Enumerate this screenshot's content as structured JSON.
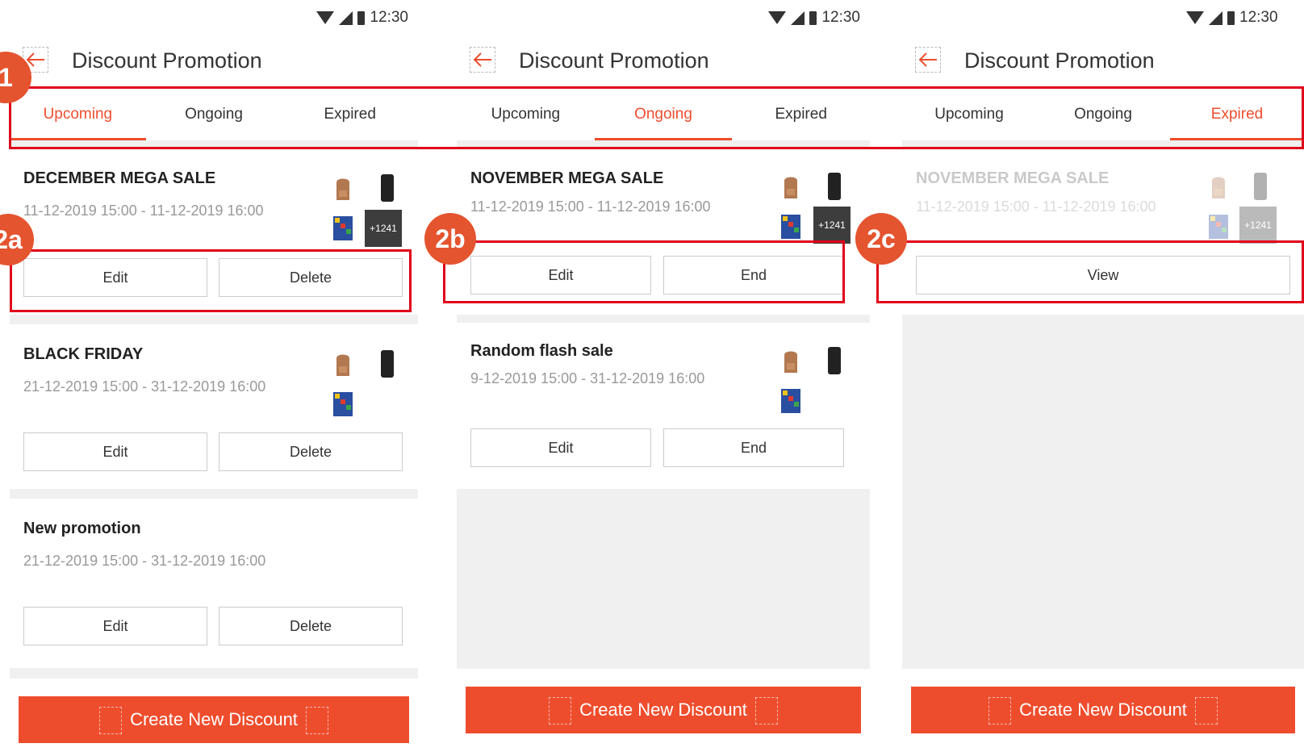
{
  "status": {
    "time": "12:30"
  },
  "header": {
    "title": "Discount Promotion"
  },
  "tabs": [
    "Upcoming",
    "Ongoing",
    "Expired"
  ],
  "labels": {
    "edit": "Edit",
    "delete": "Delete",
    "end": "End",
    "view": "View",
    "create": "Create New Discount",
    "more_count": "+1241"
  },
  "screens": [
    {
      "active_tab": "Upcoming",
      "items": [
        {
          "name": "DECEMBER MEGA SALE",
          "date": "11-12-2019 15:00 - 11-12-2019 16:00"
        },
        {
          "name": "BLACK FRIDAY",
          "date": "21-12-2019 15:00 - 31-12-2019 16:00"
        },
        {
          "name": "New promotion",
          "date": "21-12-2019 15:00 - 31-12-2019 16:00"
        }
      ]
    },
    {
      "active_tab": "Ongoing",
      "items": [
        {
          "name": "NOVEMBER MEGA SALE",
          "date": "11-12-2019 15:00 - 11-12-2019 16:00"
        },
        {
          "name": "Random flash sale",
          "date": "9-12-2019 15:00 - 31-12-2019 16:00"
        }
      ]
    },
    {
      "active_tab": "Expired",
      "items": [
        {
          "name": "NOVEMBER MEGA SALE",
          "date": "11-12-2019 15:00 - 11-12-2019 16:00"
        }
      ]
    }
  ],
  "annotations": {
    "a1": "1",
    "a2a": "2a",
    "a2b": "2b",
    "a2c": "2c"
  },
  "colors": {
    "accent": "#ee4d2d",
    "highlight": "#e0001a",
    "badge": "#e4542f"
  },
  "icons": [
    "back-arrow-icon",
    "wifi-icon",
    "signal-icon",
    "battery-icon",
    "backpack-icon",
    "speaker-icon",
    "rubiks-cube-icon"
  ]
}
